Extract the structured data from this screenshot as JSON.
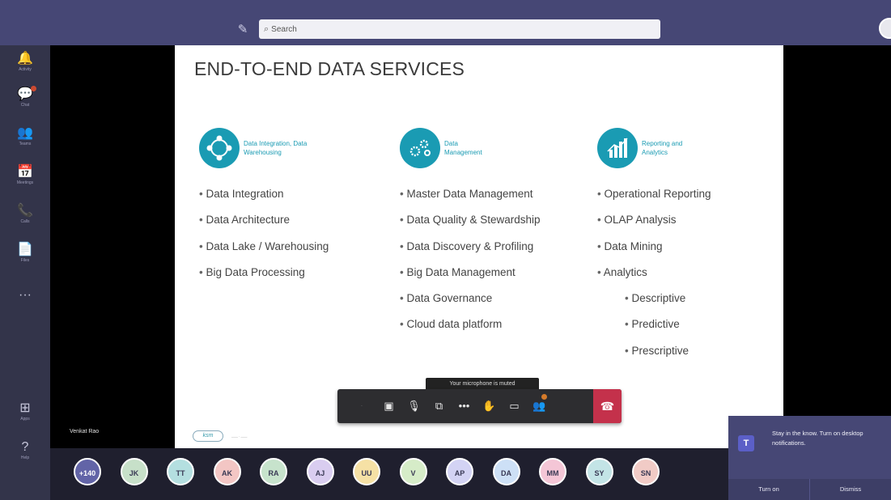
{
  "search": {
    "placeholder": "Search"
  },
  "rail": [
    {
      "icon": "bell-icon",
      "glyph": "🔔",
      "label": "Activity"
    },
    {
      "icon": "chat-icon",
      "glyph": "💬",
      "label": "Chat",
      "badge": true
    },
    {
      "icon": "teams-icon",
      "glyph": "👥",
      "label": "Teams"
    },
    {
      "icon": "calendar-icon",
      "glyph": "📅",
      "label": "Meetings"
    },
    {
      "icon": "phone-icon",
      "glyph": "📞",
      "label": "Calls"
    },
    {
      "icon": "file-icon",
      "glyph": "📄",
      "label": "Files"
    },
    {
      "icon": "more-icon",
      "glyph": "···",
      "label": ""
    },
    {
      "icon": "apps-icon",
      "glyph": "⊞",
      "label": "Apps"
    },
    {
      "icon": "help-icon",
      "glyph": "?",
      "label": "Help"
    }
  ],
  "slide": {
    "title": "END-TO-END DATA SERVICES",
    "columns": [
      {
        "heading": "Data Integration, Data Warehousing",
        "icon": "integration-icon",
        "items": [
          "Data Integration",
          "Data Architecture",
          "Data Lake / Warehousing",
          "Big Data Processing"
        ]
      },
      {
        "heading": "Data Management",
        "icon": "gears-icon",
        "items": [
          "Master Data Management",
          "Data Quality & Stewardship",
          "Data Discovery & Profiling",
          "Big Data Management",
          "Data Governance",
          "Cloud data platform"
        ]
      },
      {
        "heading": "Reporting and Analytics",
        "icon": "bar-chart-icon",
        "items": [
          "Operational Reporting",
          "OLAP Analysis",
          "Data Mining",
          "Analytics"
        ],
        "subitems": [
          "Descriptive",
          "Predictive",
          "Prescriptive"
        ]
      }
    ]
  },
  "presenter": "Venkat Rao",
  "tooltip": "Your microphone is muted",
  "participants": [
    {
      "initials": "+140",
      "color": "#6264a7",
      "text": "#ffffff"
    },
    {
      "initials": "JK",
      "color": "#c7e0c9"
    },
    {
      "initials": "TT",
      "color": "#b4dfe0"
    },
    {
      "initials": "AK",
      "color": "#f3c6c4"
    },
    {
      "initials": "RA",
      "color": "#c7e3cc"
    },
    {
      "initials": "AJ",
      "color": "#d9cdf0"
    },
    {
      "initials": "UU",
      "color": "#f6e1a5"
    },
    {
      "initials": "V",
      "color": "#d6ecc8"
    },
    {
      "initials": "AP",
      "color": "#d3d3f4"
    },
    {
      "initials": "DA",
      "color": "#cde0f6"
    },
    {
      "initials": "MM",
      "color": "#f4c6d6"
    },
    {
      "initials": "SY",
      "color": "#c3e4e6"
    },
    {
      "initials": "SN",
      "color": "#f1cbc6"
    }
  ],
  "toast": {
    "message": "Stay in the know. Turn on desktop notifications.",
    "turn_on": "Turn on",
    "dismiss": "Dismiss"
  }
}
